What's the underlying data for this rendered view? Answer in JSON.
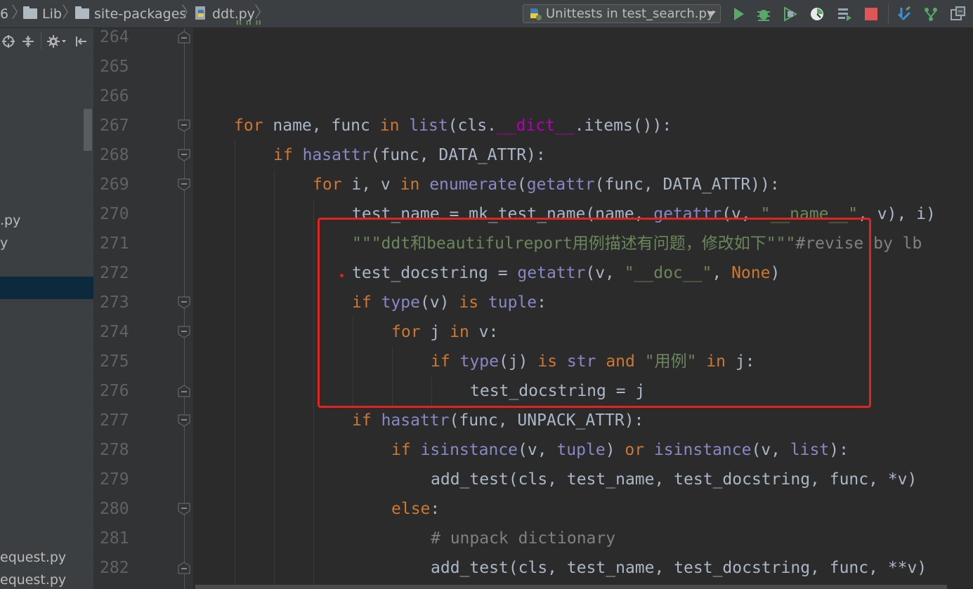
{
  "breadcrumb": {
    "items": [
      "6",
      "Lib",
      "site-packages",
      "ddt.py"
    ]
  },
  "toolbar": {
    "run_config_label": "Unittests in test_search.py",
    "icons": [
      "run-icon",
      "debug-icon",
      "coverage-icon",
      "profile-icon",
      "run-tasks-icon",
      "stop-icon",
      "vcs-update-icon",
      "vcs-branches-icon",
      "vcs-changes-icon"
    ]
  },
  "project_panel": {
    "tool_icons": [
      "target-icon",
      "collapse-all-icon",
      "gear-icon",
      "hide-panel-icon"
    ],
    "items": [
      ".py",
      "y",
      "equest.py",
      "equest.py"
    ]
  },
  "editor": {
    "partial_top": "\"\"\"",
    "lines": [
      {
        "n": "264"
      },
      {
        "n": "265"
      },
      {
        "n": "266"
      },
      {
        "n": "267"
      },
      {
        "n": "268"
      },
      {
        "n": "269"
      },
      {
        "n": "270"
      },
      {
        "n": "271"
      },
      {
        "n": "272"
      },
      {
        "n": "273"
      },
      {
        "n": "274"
      },
      {
        "n": "275"
      },
      {
        "n": "276"
      },
      {
        "n": "277"
      },
      {
        "n": "278"
      },
      {
        "n": "279"
      },
      {
        "n": "280"
      },
      {
        "n": "281"
      },
      {
        "n": "282"
      }
    ],
    "code": {
      "l267": [
        "for",
        " name, func ",
        "in",
        " ",
        "list",
        "(cls.",
        "__dict__",
        ".items()):"
      ],
      "l268": [
        "if",
        " ",
        "hasattr",
        "(func, DATA_ATTR):"
      ],
      "l269": [
        "for",
        " i, v ",
        "in",
        " ",
        "enumerate",
        "(",
        "getattr",
        "(func, DATA_ATTR)):"
      ],
      "l270": [
        "test_name = mk_test_name(name, ",
        "getattr",
        "(v, ",
        "\"__name__\"",
        ", v), i)"
      ],
      "l271": [
        "\"\"\"ddt和beautifulreport用例描述有问题，修改如下\"\"\"",
        "#revise by lb"
      ],
      "l272": [
        "test_docstring = ",
        "getattr",
        "(v, ",
        "\"__doc__\"",
        ", ",
        "None",
        ")"
      ],
      "l273": [
        "if",
        " ",
        "type",
        "(v) ",
        "is",
        " ",
        "tuple",
        ":"
      ],
      "l274": [
        "for",
        " j ",
        "in",
        " v:"
      ],
      "l275": [
        "if",
        " ",
        "type",
        "(j) ",
        "is",
        " ",
        "str",
        " ",
        "and",
        " ",
        "\"用例\"",
        " ",
        "in",
        " j:"
      ],
      "l276": [
        "test_docstring = j"
      ],
      "l277": [
        "if",
        " ",
        "hasattr",
        "(func, UNPACK_ATTR):"
      ],
      "l278": [
        "if",
        " ",
        "isinstance",
        "(v, ",
        "tuple",
        ") ",
        "or",
        " ",
        "isinstance",
        "(v, ",
        "list",
        "):"
      ],
      "l279": [
        "add_test(cls, test_name, test_docstring, func, *v)"
      ],
      "l280": [
        "else",
        ":"
      ],
      "l281": [
        "# unpack dictionary"
      ],
      "l282": [
        "add_test(cls, test_name, test_docstring, func, **v)"
      ]
    },
    "annotation_color": "#e0241e"
  }
}
